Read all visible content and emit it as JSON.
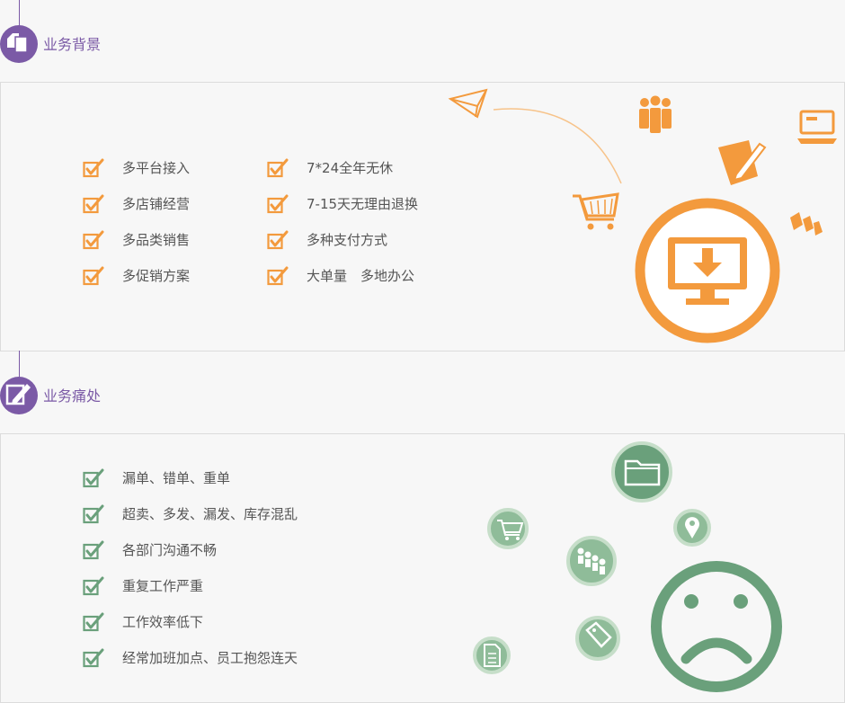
{
  "section1": {
    "title": "业务背景",
    "icon": "documents-icon",
    "column1": [
      "多平台接入",
      "多店铺经营",
      "多品类销售",
      "多促销方案"
    ],
    "column2": [
      "7*24全年无休",
      "7-15天无理由退换",
      "多种支付方式",
      "大单量　多地办公"
    ]
  },
  "section2": {
    "title": "业务痛处",
    "icon": "edit-icon",
    "items": [
      "漏单、错单、重单",
      "超卖、多发、漏发、库存混乱",
      "各部门沟通不畅",
      "重复工作严重",
      "工作效率低下",
      "经常加班加点、员工抱怨连天"
    ]
  },
  "colors": {
    "purple": "#7b5aa6",
    "orange": "#f39a3d",
    "green": "#6aa07b",
    "light_green": "#a9ceb1",
    "text": "#555555",
    "border": "#dcdcdc"
  }
}
